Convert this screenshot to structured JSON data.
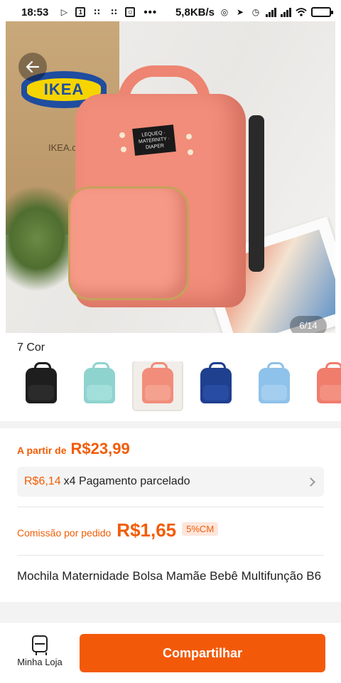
{
  "status_bar": {
    "time": "18:53",
    "net_speed": "5,8KB/s",
    "dots": "•••"
  },
  "gallery": {
    "counter": "6/14",
    "back_icon": "arrow-left-icon",
    "background_text": {
      "logo": "IKEA",
      "site": "IKEA.c"
    },
    "label_text": "LEQUEQ · MATERNITY · DIAPER"
  },
  "colors": {
    "title": "7 Cor",
    "swatches": [
      {
        "name": "black",
        "color": "#1e1e1e",
        "pocket": "#2e2e2e"
      },
      {
        "name": "mint-pair",
        "color": "#8fd3cf",
        "pocket": "#a6e0dc"
      },
      {
        "name": "pink-photo",
        "color": "#f18d7a",
        "pocket": "#f6a493",
        "selected": true
      },
      {
        "name": "navy",
        "color": "#1f3f8f",
        "pocket": "#2a4fa6"
      },
      {
        "name": "light-blue",
        "color": "#8fc2ea",
        "pocket": "#a7d0f0"
      },
      {
        "name": "salmon",
        "color": "#f07c6c",
        "pocket": "#f49484"
      }
    ]
  },
  "pricing": {
    "prefix": "A partir de",
    "price": "R$23,99",
    "installment_amount": "R$6,14",
    "installment_label": "x4 Pagamento parcelado",
    "commission_label": "Comissão por pedido",
    "commission_value": "R$1,65",
    "commission_badge": "5%CM"
  },
  "product": {
    "title": "Mochila Maternidade Bolsa Mamãe Bebê Multifunção  B6"
  },
  "bottom_bar": {
    "store_label": "Minha Loja",
    "share_label": "Compartilhar"
  },
  "theme": {
    "accent": "#f25a0a"
  }
}
